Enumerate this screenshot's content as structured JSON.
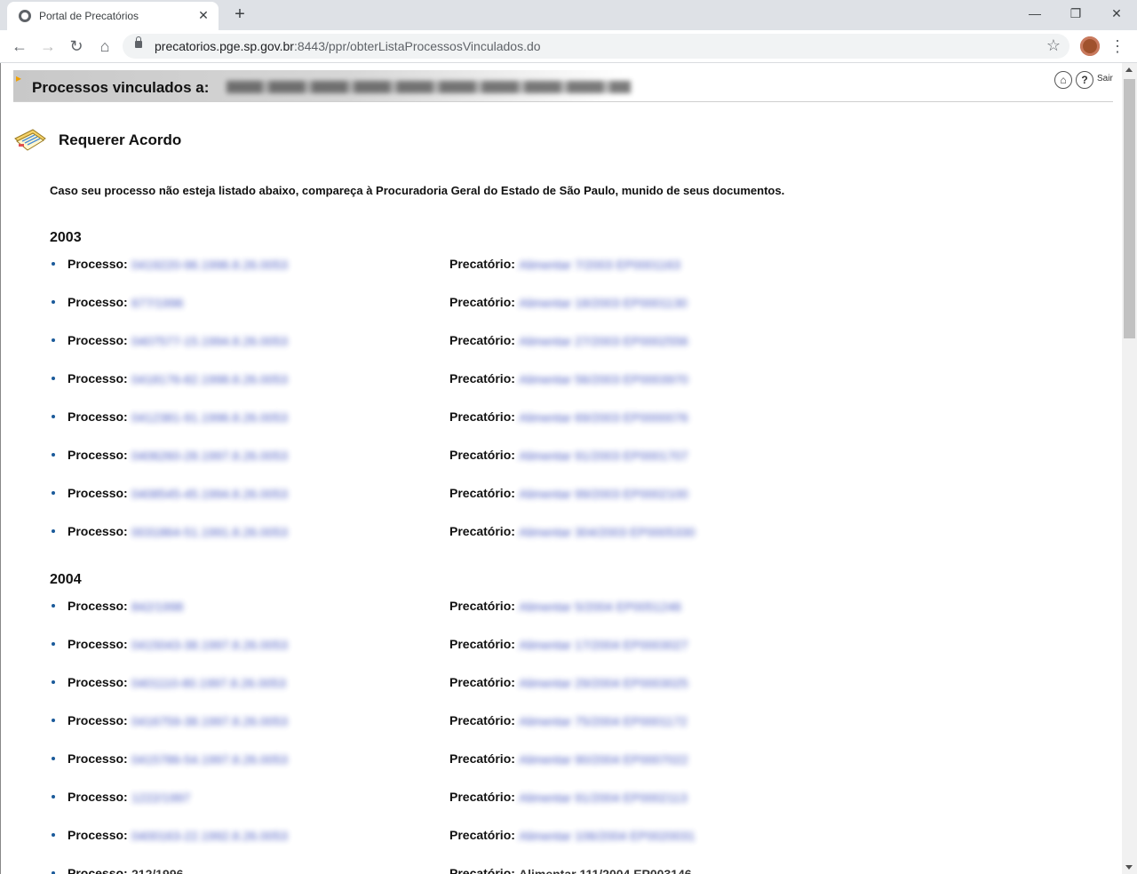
{
  "browser": {
    "tab_title": "Portal de Precatórios",
    "url_host": "precatorios.pge.sp.gov.br",
    "url_path": ":8443/ppr/obterListaProcessosVinculados.do"
  },
  "header": {
    "title": "Processos vinculados a:",
    "owner_name": "FREIRE BOGIS SAKAMOTO VIOLANTE ADVOGADOS",
    "exit_label": "Sair"
  },
  "section": {
    "title": "Requerer Acordo",
    "notice": "Caso seu processo não esteja listado abaixo, compareça à Procuradoria Geral do Estado de São Paulo, munido de seus documentos."
  },
  "labels": {
    "processo": "Processo:",
    "precatorio": "Precatório:"
  },
  "groups": [
    {
      "year": "2003",
      "items": [
        {
          "processo": "0419220-96.1996.8.26.0053",
          "precatorio": "Alimentar 7/2003 EP0001163"
        },
        {
          "processo": "677/1996",
          "precatorio": "Alimentar 18/2003 EP0001130"
        },
        {
          "processo": "0407577-15.1994.8.26.0053",
          "precatorio": "Alimentar 27/2003 EP0002556"
        },
        {
          "processo": "0418176-82.1998.8.26.0053",
          "precatorio": "Alimentar 56/2003 EP0003970"
        },
        {
          "processo": "0412381-91.1996.8.26.0053",
          "precatorio": "Alimentar 69/2003 EP0000076"
        },
        {
          "processo": "0406260-28.1997.8.26.0053",
          "precatorio": "Alimentar 91/2003 EP0001707"
        },
        {
          "processo": "0408545-45.1994.8.26.0053",
          "precatorio": "Alimentar 99/2003 EP0002100"
        },
        {
          "processo": "0031864-51.1991.8.26.0053",
          "precatorio": "Alimentar 304/2003 EP0005330"
        }
      ]
    },
    {
      "year": "2004",
      "items": [
        {
          "processo": "842/1998",
          "precatorio": "Alimentar 5/2004 EP0051246"
        },
        {
          "processo": "0415043-38.1997.8.26.0053",
          "precatorio": "Alimentar 17/2004 EP0003027"
        },
        {
          "processo": "0401110-80.1997.8.26.0053",
          "precatorio": "Alimentar 29/2004 EP0003025"
        },
        {
          "processo": "0416759-38.1997.8.26.0053",
          "precatorio": "Alimentar 75/2004 EP0001172"
        },
        {
          "processo": "0415786-54.1997.8.26.0053",
          "precatorio": "Alimentar 90/2004 EP0007022"
        },
        {
          "processo": "1222/1997",
          "precatorio": "Alimentar 91/2004 EP0002113"
        },
        {
          "processo": "0400163-22.1992.8.26.0053",
          "precatorio": "Alimentar 106/2004 EP0020031"
        },
        {
          "processo": "212/1996",
          "precatorio": "Alimentar 111/2004 EP003146"
        }
      ]
    }
  ]
}
